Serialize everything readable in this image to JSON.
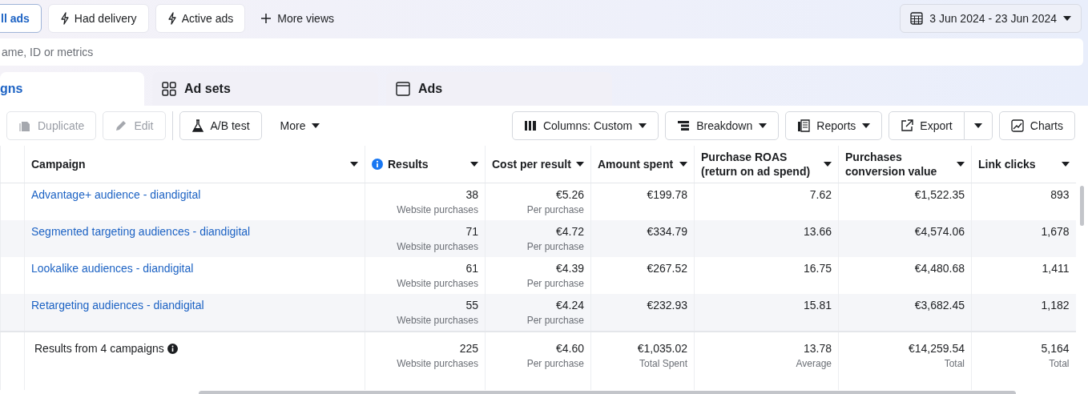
{
  "view_chips": [
    {
      "label": "ll ads",
      "selected": true
    },
    {
      "label": "Had delivery",
      "selected": false
    },
    {
      "label": "Active ads",
      "selected": false
    }
  ],
  "more_views": "More views",
  "date_range": "3 Jun 2024 - 23 Jun 2024",
  "search": {
    "placeholder": "ame, ID or metrics"
  },
  "tabs": [
    {
      "label": "gns",
      "selected": true
    },
    {
      "label": "Ad sets",
      "selected": false
    },
    {
      "label": "Ads",
      "selected": false
    }
  ],
  "toolbar_left": [
    {
      "label": "Duplicate",
      "disabled": true
    },
    {
      "label": "Edit",
      "disabled": true
    },
    {
      "label": "A/B test",
      "disabled": false
    },
    {
      "label": "More",
      "disabled": false
    }
  ],
  "toolbar_right": [
    {
      "label": "Columns: Custom"
    },
    {
      "label": "Breakdown"
    },
    {
      "label": "Reports"
    },
    {
      "label": "Export"
    },
    {
      "label": "Charts"
    }
  ],
  "table": {
    "columns": [
      {
        "label": "Campaign",
        "info": false
      },
      {
        "label": "Results",
        "info": true
      },
      {
        "label": "Cost per result",
        "info": false
      },
      {
        "label": "Amount spent",
        "info": false
      },
      {
        "label": "Purchase ROAS (return on ad spend)",
        "info": false
      },
      {
        "label": "Purchases conversion value",
        "info": false
      },
      {
        "label": "Link clicks",
        "info": false
      }
    ],
    "rows": [
      {
        "cells": [
          {
            "value": "Advantage+ audience - diandigital"
          },
          {
            "value": "38",
            "sub": "Website purchases"
          },
          {
            "value": "€5.26",
            "sub": "Per purchase"
          },
          {
            "value": "€199.78"
          },
          {
            "value": "7.62"
          },
          {
            "value": "€1,522.35"
          },
          {
            "value": "893"
          }
        ]
      },
      {
        "cells": [
          {
            "value": "Segmented targeting audiences - diandigital"
          },
          {
            "value": "71",
            "sub": "Website purchases"
          },
          {
            "value": "€4.72",
            "sub": "Per purchase"
          },
          {
            "value": "€334.79"
          },
          {
            "value": "13.66"
          },
          {
            "value": "€4,574.06"
          },
          {
            "value": "1,678"
          }
        ]
      },
      {
        "cells": [
          {
            "value": "Lookalike audiences - diandigital"
          },
          {
            "value": "61",
            "sub": "Website purchases"
          },
          {
            "value": "€4.39",
            "sub": "Per purchase"
          },
          {
            "value": "€267.52"
          },
          {
            "value": "16.75"
          },
          {
            "value": "€4,480.68"
          },
          {
            "value": "1,411"
          }
        ]
      },
      {
        "cells": [
          {
            "value": "Retargeting audiences - diandigital"
          },
          {
            "value": "55",
            "sub": "Website purchases"
          },
          {
            "value": "€4.24",
            "sub": "Per purchase"
          },
          {
            "value": "€232.93"
          },
          {
            "value": "15.81"
          },
          {
            "value": "€3,682.45"
          },
          {
            "value": "1,182"
          }
        ]
      }
    ],
    "totals": {
      "cells": [
        {
          "value": "Results from 4 campaigns"
        },
        {
          "value": "225",
          "sub": "Website purchases"
        },
        {
          "value": "€4.60",
          "sub": "Per purchase"
        },
        {
          "value": "€1,035.02",
          "sub": "Total Spent"
        },
        {
          "value": "13.78",
          "sub": "Average"
        },
        {
          "value": "€14,259.54",
          "sub": "Total"
        },
        {
          "value": "5,164",
          "sub": "Total"
        }
      ]
    }
  }
}
